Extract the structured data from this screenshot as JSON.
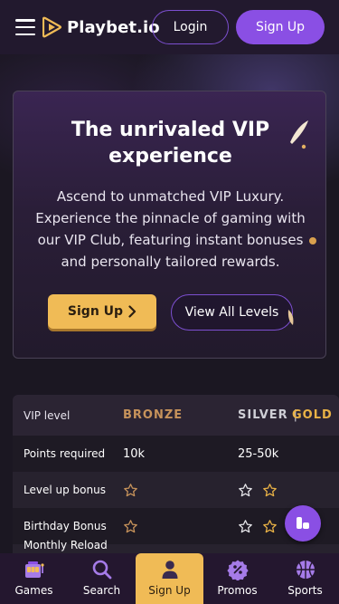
{
  "header": {
    "brand": "Playbet.io",
    "login_label": "Login",
    "signup_label": "Sign Up"
  },
  "hero": {
    "title": "The unrivaled VIP experience",
    "description": "Ascend to unmatched VIP Luxury. Experience the pinnacle of gaming with our VIP Club, featuring instant bonuses and personally tailored rewards.",
    "signup_label": "Sign Up",
    "levels_label": "View All Levels"
  },
  "vip_table": {
    "header_label": "VIP level",
    "levels": [
      "BRONZE",
      "SILVER",
      "GOLD"
    ],
    "separator": "|",
    "rows": [
      {
        "label": "Points required",
        "bronze": "10k",
        "silver": "25-50k"
      },
      {
        "label": "Level up bonus",
        "bronze_stars": 1,
        "silver_stars": 2
      },
      {
        "label": "Birthday Bonus",
        "bronze_stars": 1,
        "silver_stars": 2
      },
      {
        "label": "Monthly Reload"
      }
    ]
  },
  "bottom_nav": {
    "items": [
      {
        "label": "Games",
        "icon": "slot-machine-icon"
      },
      {
        "label": "Search",
        "icon": "search-icon"
      },
      {
        "label": "Sign Up",
        "icon": "user-icon"
      },
      {
        "label": "Promos",
        "icon": "percent-badge-icon"
      },
      {
        "label": "Sports",
        "icon": "basketball-icon"
      }
    ]
  },
  "colors": {
    "accent_purple": "#8a4fe4",
    "accent_gold": "#f0bb56",
    "bronze": "#c7935b",
    "gold": "#e9b246"
  }
}
